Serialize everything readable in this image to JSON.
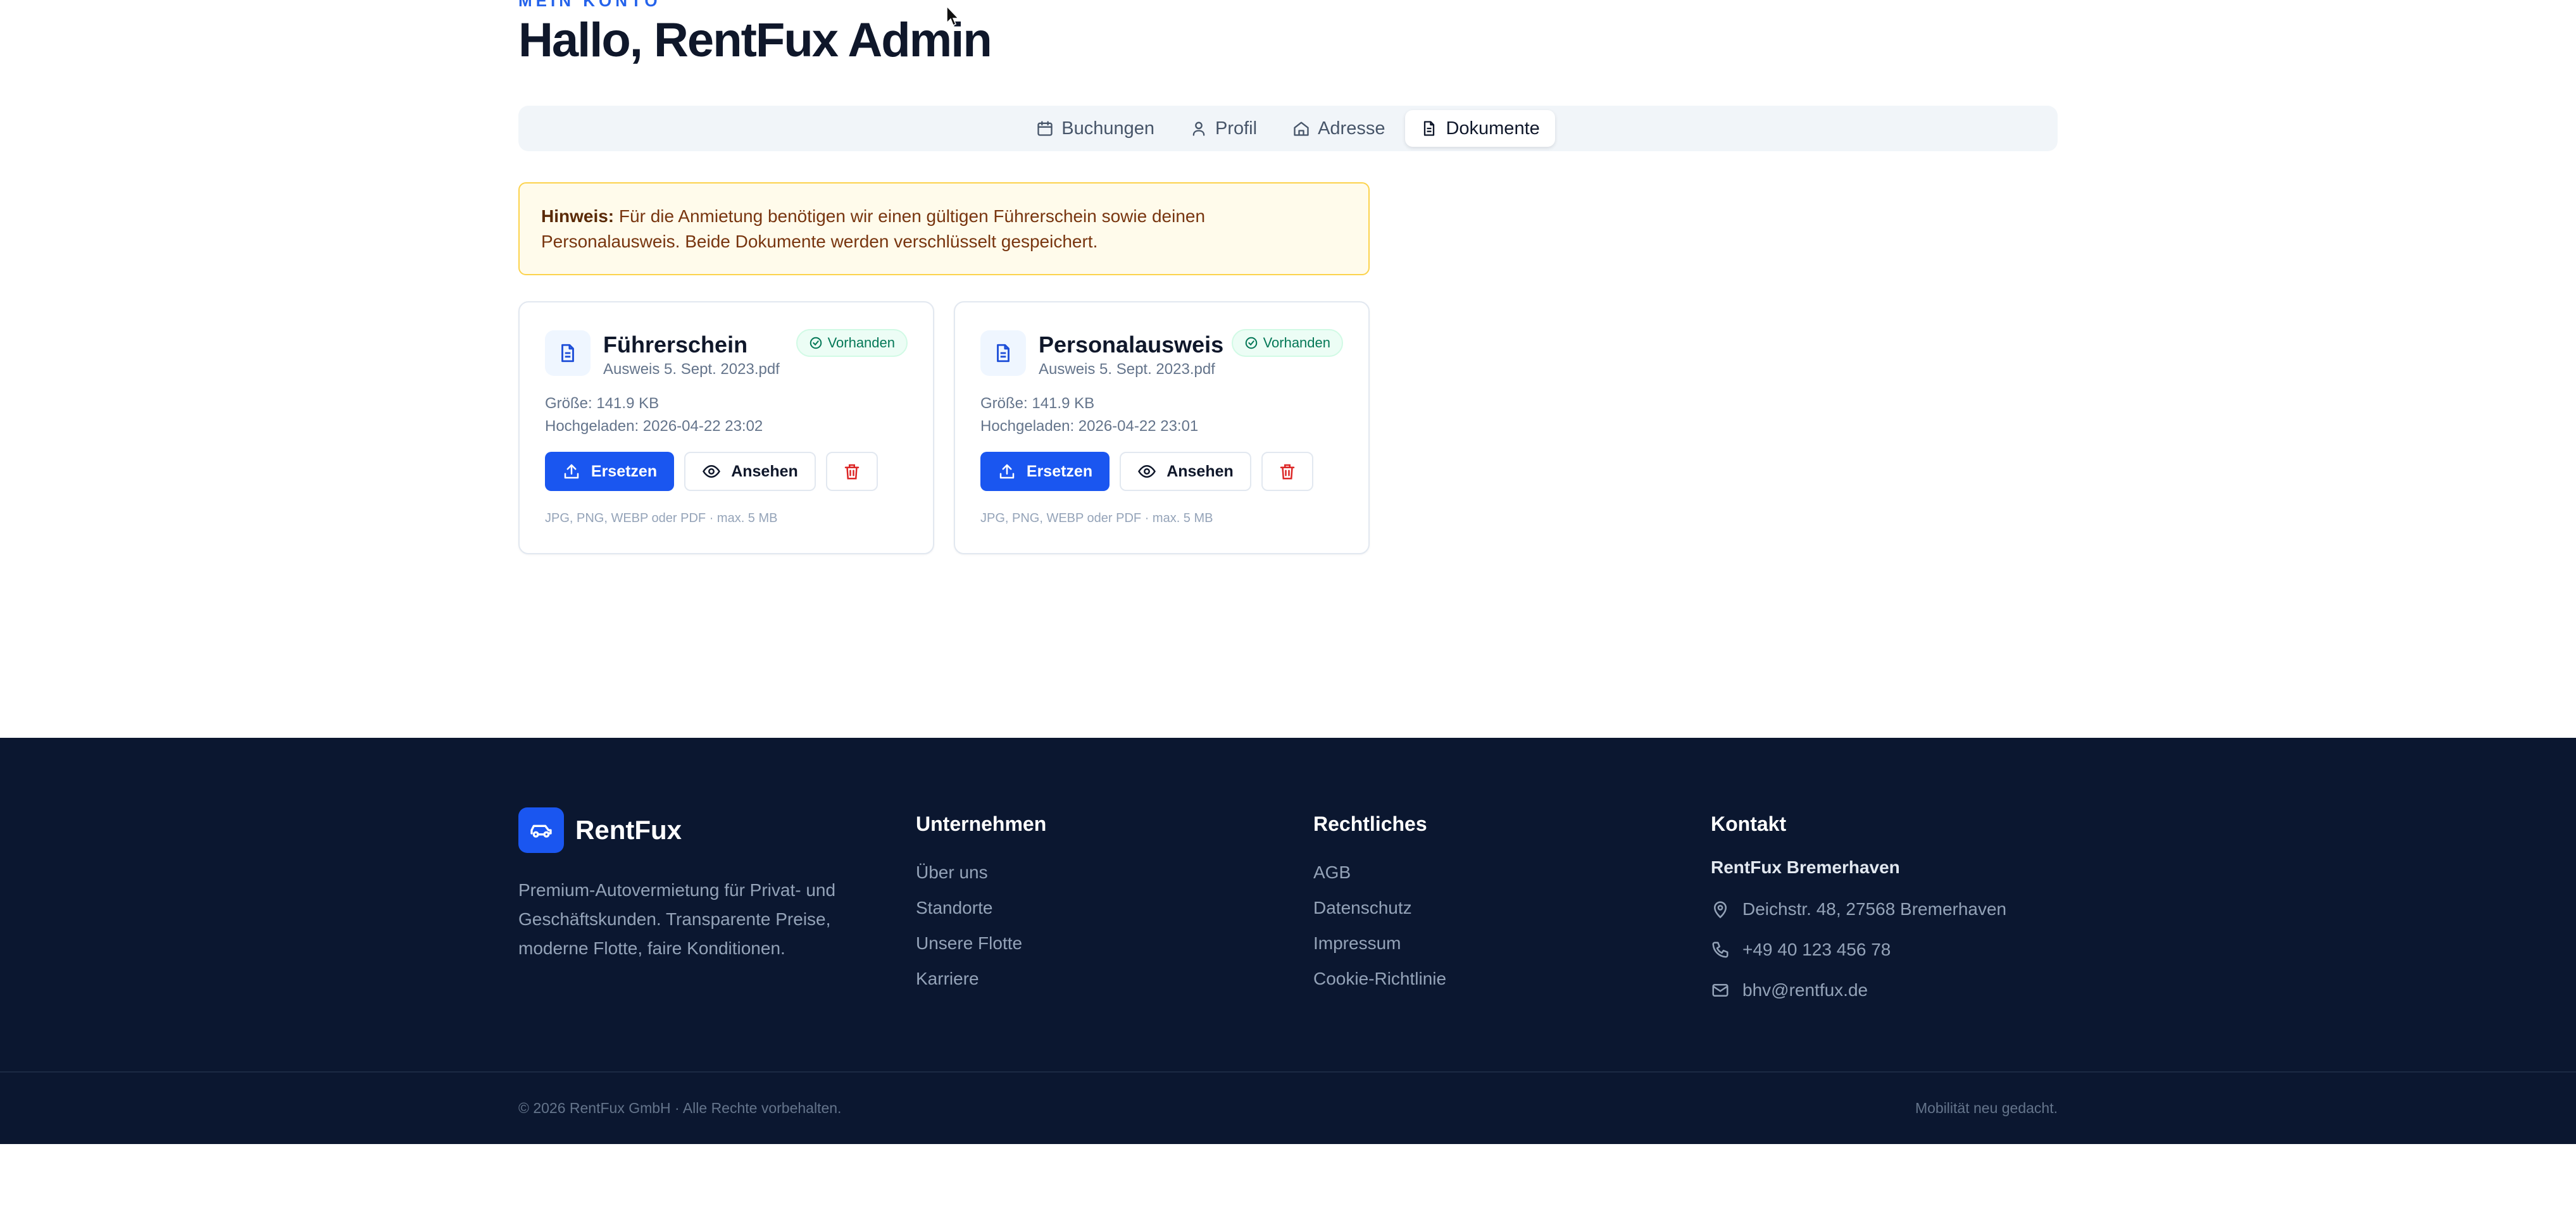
{
  "header": {
    "eyebrow": "MEIN KONTO",
    "title": "Hallo, RentFux Admin"
  },
  "tabs": [
    {
      "label": "Buchungen",
      "icon": "calendar-icon",
      "active": false
    },
    {
      "label": "Profil",
      "icon": "user-icon",
      "active": false
    },
    {
      "label": "Adresse",
      "icon": "home-icon",
      "active": false
    },
    {
      "label": "Dokumente",
      "icon": "file-text-icon",
      "active": true
    }
  ],
  "notice": {
    "prefix": "Hinweis:",
    "text": " Für die Anmietung benötigen wir einen gültigen Führerschein sowie deinen Personalausweis. Beide Dokumente werden verschlüsselt gespeichert."
  },
  "documents": [
    {
      "title": "Führerschein",
      "file": "Ausweis 5. Sept. 2023.pdf",
      "status": "Vorhanden",
      "size": "Größe: 141.9 KB",
      "uploaded": "Hochgeladen: 2026-04-22 23:02",
      "replace_label": "Ersetzen",
      "view_label": "Ansehen",
      "hint": "JPG, PNG, WEBP oder PDF · max. 5 MB"
    },
    {
      "title": "Personalausweis",
      "file": "Ausweis 5. Sept. 2023.pdf",
      "status": "Vorhanden",
      "size": "Größe: 141.9 KB",
      "uploaded": "Hochgeladen: 2026-04-22 23:01",
      "replace_label": "Ersetzen",
      "view_label": "Ansehen",
      "hint": "JPG, PNG, WEBP oder PDF · max. 5 MB"
    }
  ],
  "footer": {
    "brand": "RentFux",
    "description": "Premium-Autovermietung für Privat- und Geschäftskunden. Transparente Preise, moderne Flotte, faire Konditionen.",
    "company": {
      "heading": "Unternehmen",
      "links": [
        "Über uns",
        "Standorte",
        "Unsere Flotte",
        "Karriere"
      ]
    },
    "legal": {
      "heading": "Rechtliches",
      "links": [
        "AGB",
        "Datenschutz",
        "Impressum",
        "Cookie-Richtlinie"
      ]
    },
    "contact": {
      "heading": "Kontakt",
      "branch": "RentFux Bremerhaven",
      "address": "Deichstr. 48, 27568 Bremerhaven",
      "phone": "+49 40 123 456 78",
      "email": "bhv@rentfux.de"
    },
    "copyright": "© 2026 RentFux GmbH · Alle Rechte vorbehalten.",
    "tagline": "Mobilität neu gedacht."
  },
  "colors": {
    "accent": "#1a56f0",
    "footer_bg": "#0b1730",
    "notice_bg": "#fffbeb",
    "success": "#047857",
    "danger": "#dc2626"
  }
}
